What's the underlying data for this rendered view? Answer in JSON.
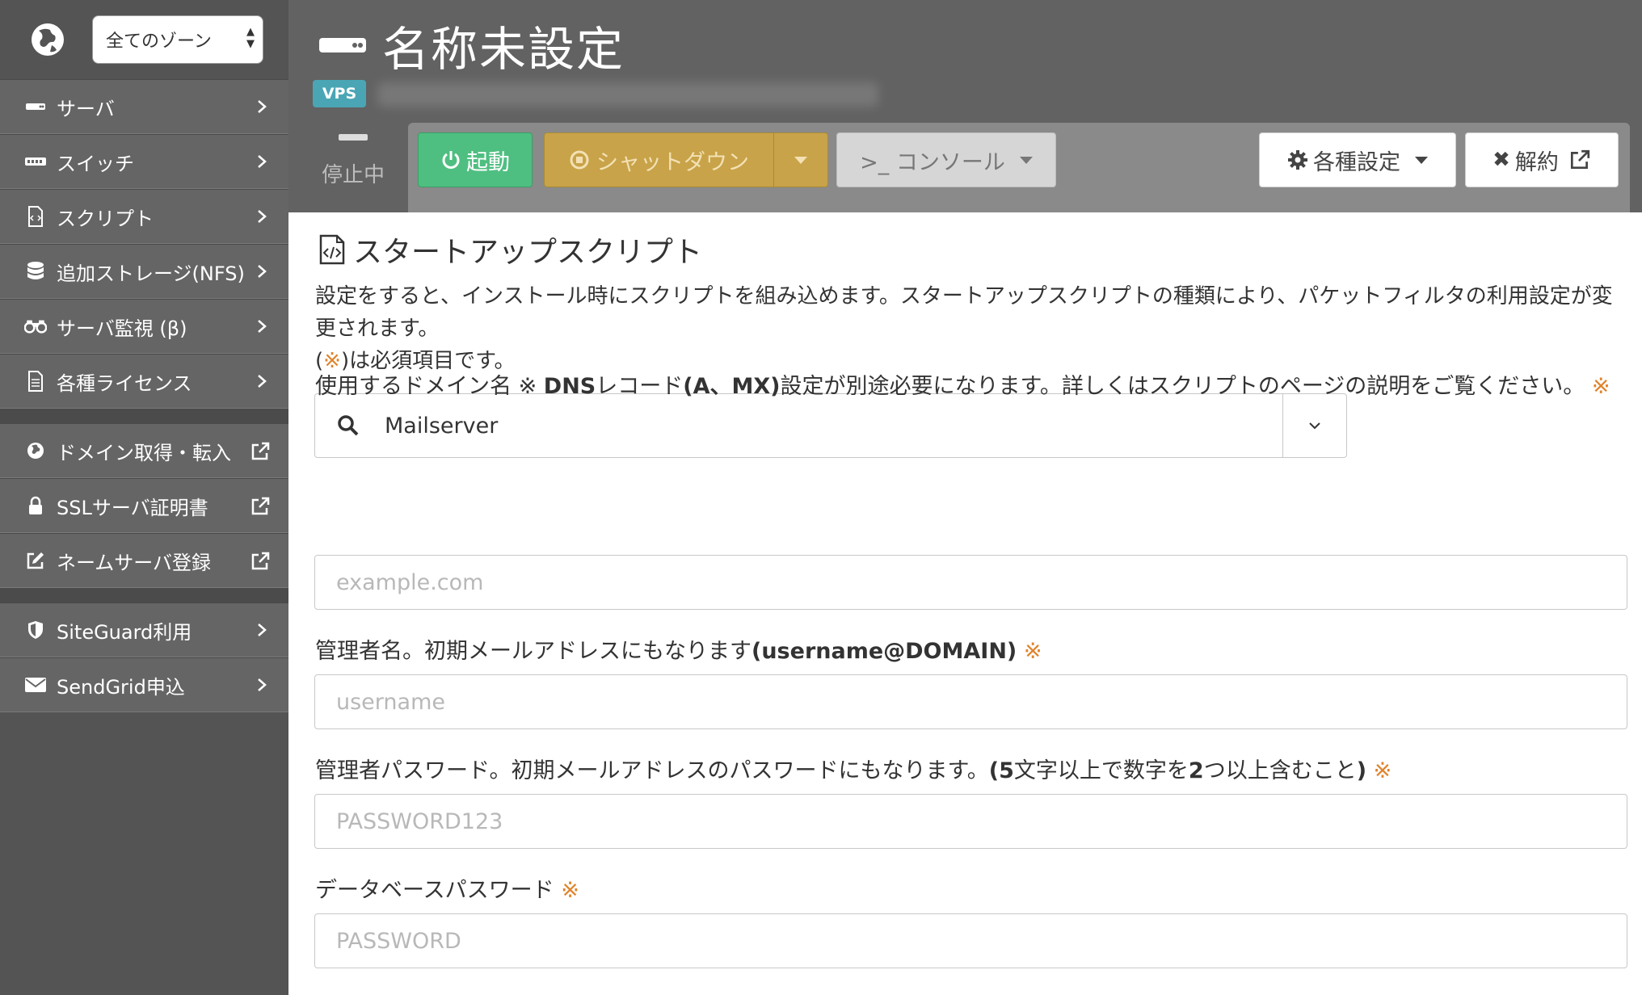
{
  "sidebar": {
    "zone_select": "全てのゾーン",
    "groups": [
      {
        "items": [
          {
            "label": "サーバ",
            "icon": "server-icon"
          },
          {
            "label": "スイッチ",
            "icon": "switch-icon"
          },
          {
            "label": "スクリプト",
            "icon": "script-icon"
          },
          {
            "label": "追加ストレージ(NFS)",
            "icon": "database-icon"
          },
          {
            "label": "サーバ監視 (β)",
            "icon": "binoculars-icon"
          },
          {
            "label": "各種ライセンス",
            "icon": "document-icon"
          }
        ]
      },
      {
        "items": [
          {
            "label": "ドメイン取得・転入",
            "icon": "globe-icon"
          },
          {
            "label": "SSLサーバ証明書",
            "icon": "lock-icon"
          },
          {
            "label": "ネームサーバ登録",
            "icon": "edit-icon"
          }
        ]
      },
      {
        "items": [
          {
            "label": "SiteGuard利用",
            "icon": "shield-icon"
          },
          {
            "label": "SendGrid申込",
            "icon": "envelope-icon"
          }
        ]
      }
    ]
  },
  "header": {
    "title": "名称未設定",
    "badge": "VPS",
    "status": "停止中",
    "buttons": {
      "start": "起動",
      "shutdown": "シャットダウン",
      "console": ">_ コンソール",
      "settings": "各種設定",
      "cancel": "解約"
    }
  },
  "main": {
    "section_title": "スタートアップスクリプト",
    "desc_line1": "設定をすると、インストール時にスクリプトを組み込めます。スタートアップスクリプトの種類により、パケットフィルタの利用設定が変更されます。",
    "desc_req_prefix": "(",
    "desc_req_mark": "※",
    "desc_req_suffix": ")は必須項目です。",
    "script_select_value": "Mailserver",
    "required_mark": "※",
    "fields": [
      {
        "label_pre": "使用するドメイン名 ※ ",
        "label_bold": "DNS",
        "label_mid": "レコード",
        "label_bold2": "(A、MX)",
        "label_post": "設定が別途必要になります。詳しくはスクリプトのページの説明をご覧ください。 ",
        "placeholder": "example.com"
      },
      {
        "label_pre": "管理者名。初期メールアドレスにもなります",
        "label_bold": "(username@DOMAIN)",
        "label_post": " ",
        "placeholder": "username"
      },
      {
        "label_pre": "管理者パスワード。初期メールアドレスのパスワードにもなります。",
        "label_bold": "(5",
        "label_mid": "文字以上で数字を",
        "label_bold2": "2",
        "label_post": "つ以上含むこと",
        "label_bold3": ")",
        "placeholder": "PASSWORD123"
      },
      {
        "label_pre": "データベースパスワード ",
        "placeholder": "PASSWORD"
      }
    ]
  },
  "colors": {
    "sidebar_bg": "#545454",
    "header_bg": "#626262",
    "start_green": "#4fbf81",
    "shutdown_gold": "#c8a349",
    "badge_teal": "#4aa6b5",
    "required_orange": "#e0832a"
  }
}
